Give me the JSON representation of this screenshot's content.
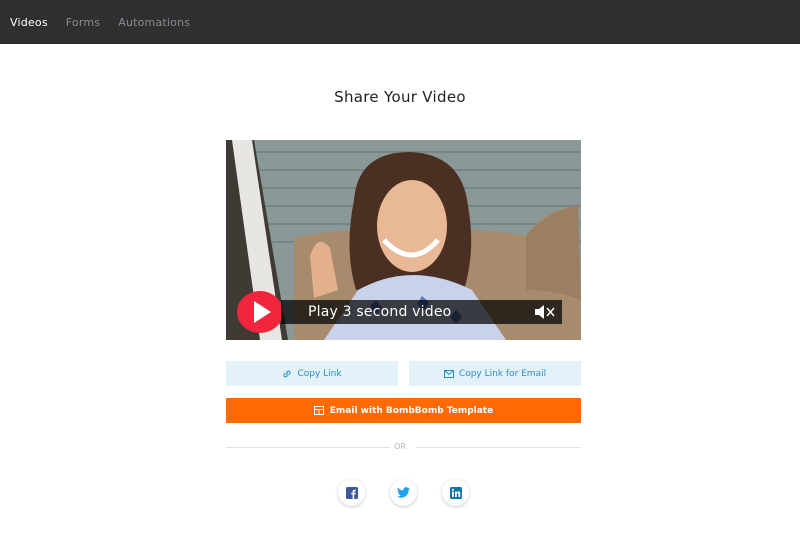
{
  "nav": {
    "items": [
      {
        "label": "Videos",
        "active": true
      },
      {
        "label": "Forms",
        "active": false
      },
      {
        "label": "Automations",
        "active": false
      }
    ]
  },
  "page": {
    "title": "Share Your Video"
  },
  "video": {
    "play_label": "Play 3 second video",
    "muted": true
  },
  "actions": {
    "copy_link": "Copy Link",
    "copy_link_email": "Copy Link for Email",
    "email_template": "Email with BombBomb Template"
  },
  "divider": {
    "label": "OR"
  },
  "social": [
    {
      "name": "facebook-icon"
    },
    {
      "name": "twitter-icon"
    },
    {
      "name": "linkedin-icon"
    }
  ],
  "colors": {
    "topbar": "#2e2f31",
    "accent_orange": "#ff6a06",
    "light_button": "#e3f2f9",
    "link_blue": "#2a8fbd",
    "play_red": "#f0263d"
  }
}
